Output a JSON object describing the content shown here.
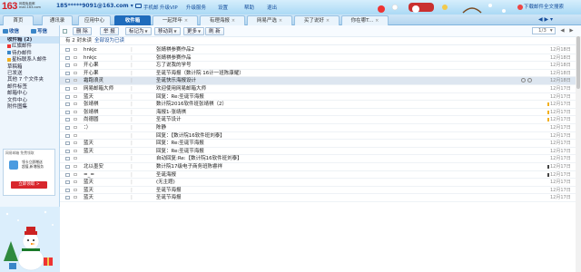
{
  "header": {
    "logo_num": "163",
    "logo_sub1": "网易免费邮",
    "logo_sub2": "mail.163.com",
    "account": "185*****9091@163.com",
    "account_caret": "▾",
    "links": [
      "手机邮",
      "升级VIP",
      "升级服务",
      "设置",
      "帮助",
      "退出"
    ],
    "skin_label": "下载邮件全文搜索"
  },
  "tabs": [
    {
      "label": "首页",
      "active": false,
      "close": false
    },
    {
      "label": "通讯录",
      "active": false,
      "close": false
    },
    {
      "label": "应用中心",
      "active": false,
      "close": false
    },
    {
      "label": "收件箱",
      "active": true,
      "close": true
    },
    {
      "label": "一起拜年",
      "active": false,
      "close": true
    },
    {
      "label": "有理海报",
      "active": false,
      "close": true
    },
    {
      "label": "网易严选",
      "active": false,
      "close": true
    },
    {
      "label": "买了说好",
      "active": false,
      "close": true
    },
    {
      "label": "你在哪T...",
      "active": false,
      "close": true
    }
  ],
  "tabnav": "◀ ▶ ▾",
  "sidebar": {
    "write": "收信",
    "compose": "写信",
    "folders": [
      {
        "label": "收件箱 (2)",
        "active": true,
        "icon": ""
      },
      {
        "label": "红旗邮件",
        "active": false,
        "icon": "#e33"
      },
      {
        "label": "待办邮件",
        "active": false,
        "icon": "#3a86c8"
      },
      {
        "label": "星标联系人邮件",
        "active": false,
        "icon": "#f2b01e"
      },
      {
        "label": "草稿箱",
        "active": false,
        "icon": ""
      },
      {
        "label": "已发送",
        "active": false,
        "icon": ""
      },
      {
        "label": "其他 7 个文件夹",
        "active": false,
        "icon": ""
      },
      {
        "label": "邮件标签",
        "active": false,
        "icon": ""
      },
      {
        "label": "邮箱中心",
        "active": false,
        "icon": ""
      },
      {
        "label": "文件中心",
        "active": false,
        "icon": ""
      },
      {
        "label": "附件图集",
        "active": false,
        "icon": ""
      }
    ],
    "promo": {
      "header": "网易邮箱 免费领取",
      "line1": "领卡立即赠送",
      "line2": "超值,新增服务",
      "button": "立即领取 >"
    }
  },
  "toolbar": {
    "buttons": [
      {
        "label": "删 除",
        "dd": false
      },
      {
        "label": "举 报",
        "dd": false
      },
      {
        "label": "标记为",
        "dd": true
      },
      {
        "label": "移动到",
        "dd": true
      },
      {
        "label": "更多",
        "dd": true
      },
      {
        "label": "刷 新",
        "dd": false
      }
    ],
    "page": "1/3",
    "page_dd": "▾",
    "prev": "◀",
    "next": "▶"
  },
  "filter": {
    "prefix": "有 2 封未读",
    "link": "全部设为已读"
  },
  "emails": [
    {
      "from": "hnkjc",
      "subject": "张婧祺参赛作品2",
      "date": "12月18日",
      "selected": false,
      "marker": ""
    },
    {
      "from": "hnkjc",
      "subject": "张婧祺参赛作品",
      "date": "12月18日",
      "selected": false,
      "marker": ""
    },
    {
      "from": "开心果",
      "subject": "忘了说我的学号",
      "date": "12月18日",
      "selected": false,
      "marker": ""
    },
    {
      "from": "开心果",
      "subject": "圣诞节海报（数计院 16计一班陈康耀）",
      "date": "12月18日",
      "selected": false,
      "marker": ""
    },
    {
      "from": "霜跑浪灵",
      "subject": "圣诞快乐海报设计",
      "date": "12月18日",
      "selected": true,
      "marker": ""
    },
    {
      "from": "网易邮箱大师",
      "subject": "欢迎使用网易邮箱大师",
      "date": "12月17日",
      "selected": false,
      "marker": ""
    },
    {
      "from": "蓝天",
      "subject": "回复：Re:圣诞节海报",
      "date": "12月17日",
      "selected": false,
      "marker": ""
    },
    {
      "from": "张靖祺",
      "subject": "数计院2016软件班张靖祺（2）",
      "date": "12月17日",
      "selected": false,
      "marker": "#f2b01e"
    },
    {
      "from": "张靖祺",
      "subject": "海报1-张靖祺",
      "date": "12月17日",
      "selected": false,
      "marker": "#f2b01e"
    },
    {
      "from": "尚德圆",
      "subject": "圣诞节设计",
      "date": "12月17日",
      "selected": false,
      "marker": "#f2b01e"
    },
    {
      "from": "：）",
      "subject": "陈静",
      "date": "12月17日",
      "selected": false,
      "marker": ""
    },
    {
      "from": "",
      "subject": "回复：【数计院16软件班刘泰】",
      "date": "12月17日",
      "selected": false,
      "marker": ""
    },
    {
      "from": "蓝天",
      "subject": "回复：Re:圣诞节海报",
      "date": "12月17日",
      "selected": false,
      "marker": ""
    },
    {
      "from": "蓝天",
      "subject": "回复：Re:圣诞节海报",
      "date": "12月17日",
      "selected": false,
      "marker": ""
    },
    {
      "from": "",
      "subject": "自动回复:Re:【数计院16软件班刘泰】",
      "date": "12月17日",
      "selected": false,
      "marker": ""
    },
    {
      "from": "北以墨安",
      "subject": "数计院17级电子商务班陈睿祥",
      "date": "12月17日",
      "selected": false,
      "marker": "#444"
    },
    {
      "from": "=_=",
      "subject": "圣诞海报",
      "date": "12月17日",
      "selected": false,
      "marker": "#444"
    },
    {
      "from": "蓝天",
      "subject": "(无主题)",
      "date": "12月17日",
      "selected": false,
      "marker": ""
    },
    {
      "from": "蓝天",
      "subject": "圣诞节海报",
      "date": "12月17日",
      "selected": false,
      "marker": ""
    },
    {
      "from": "蓝天",
      "subject": "圣诞节海报",
      "date": "12月17日",
      "selected": false,
      "marker": ""
    }
  ]
}
